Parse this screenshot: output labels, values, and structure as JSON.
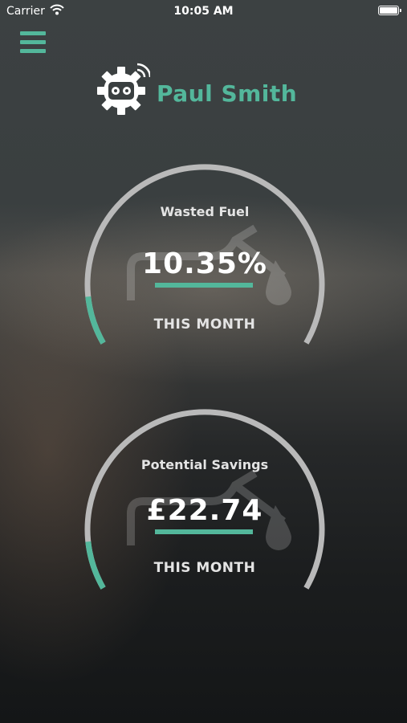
{
  "status_bar": {
    "carrier": "Carrier",
    "time": "10:05 AM"
  },
  "header": {
    "user_name": "Paul Smith"
  },
  "colors": {
    "accent": "#53b79b",
    "ring": "#b9b9b9"
  },
  "icons": {
    "menu": "hamburger-icon",
    "logo": "gear-robot-wifi-icon",
    "gauge_background": "fuel-pump-icon"
  },
  "gauges": [
    {
      "label": "Wasted Fuel",
      "value": "10.35%",
      "period": "THIS MONTH",
      "fill_fraction": 0.1
    },
    {
      "label": "Potential Savings",
      "value": "£22.74",
      "period": "THIS MONTH",
      "fill_fraction": 0.1
    }
  ]
}
